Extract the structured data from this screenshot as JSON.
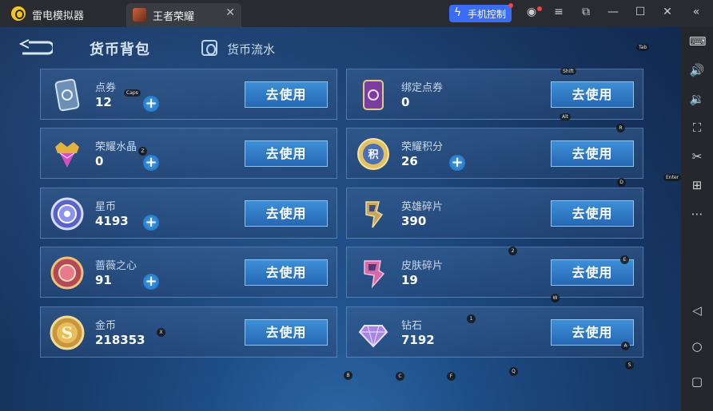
{
  "titlebar": {
    "app_name": "雷电模拟器",
    "tab_label": "王者荣耀",
    "phone_control_label": "手机控制"
  },
  "header": {
    "title": "货币背包",
    "flow_label": "货币流水"
  },
  "currencies": [
    {
      "name": "点券",
      "value": "12",
      "has_plus": true,
      "button": "去使用"
    },
    {
      "name": "绑定点券",
      "value": "0",
      "has_plus": false,
      "button": "去使用"
    },
    {
      "name": "荣耀水晶",
      "value": "0",
      "has_plus": true,
      "button": "去使用"
    },
    {
      "name": "荣耀积分",
      "value": "26",
      "has_plus": true,
      "button": "去使用"
    },
    {
      "name": "星币",
      "value": "4193",
      "has_plus": true,
      "button": "去使用"
    },
    {
      "name": "英雄碎片",
      "value": "390",
      "has_plus": false,
      "button": "去使用"
    },
    {
      "name": "蔷薇之心",
      "value": "91",
      "has_plus": true,
      "button": "去使用"
    },
    {
      "name": "皮肤碎片",
      "value": "19",
      "has_plus": false,
      "button": "去使用"
    },
    {
      "name": "金币",
      "value": "218353",
      "has_plus": false,
      "button": "去使用"
    },
    {
      "name": "钻石",
      "value": "7192",
      "has_plus": false,
      "button": "去使用"
    }
  ],
  "key_hints": {
    "tab": "Tab",
    "shift": "Shift",
    "alt": "Alt",
    "caps": "Caps",
    "enter": "Enter",
    "z": "Z",
    "r": "R",
    "d": "D",
    "two": "2",
    "e": "E",
    "w": "W",
    "one": "1",
    "x": "X",
    "a": "A",
    "b": "B",
    "c": "C",
    "f": "F",
    "q": "Q",
    "s": "S"
  },
  "colors": {
    "accent": "#3b6cf6",
    "button_blue": "#2f7bc8",
    "panel_bg": "#173a68"
  }
}
